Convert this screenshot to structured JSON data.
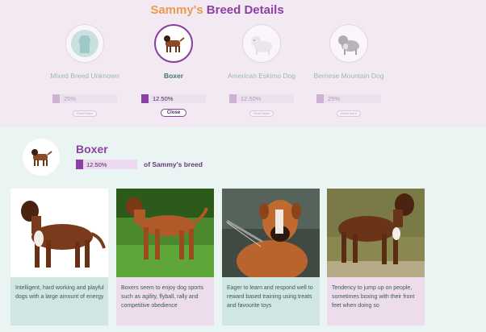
{
  "header": {
    "title_name": "Sammy's",
    "title_rest": "Breed Details"
  },
  "breeds": [
    {
      "name": "Mixed Breed Unknown",
      "percent": "25%",
      "button": "Read more",
      "state": "dim"
    },
    {
      "name": "Boxer",
      "percent": "12.50%",
      "button": "Close",
      "state": "active"
    },
    {
      "name": "American Eskimo Dog",
      "percent": "12.50%",
      "button": "Read more",
      "state": "dim"
    },
    {
      "name": "Bernese Mountain Dog",
      "percent": "25%",
      "button": "Read more",
      "state": "dim"
    }
  ],
  "detail": {
    "name": "Boxer",
    "percent": "12.50%",
    "suffix": "of Sammy's breed"
  },
  "cards": [
    {
      "caption": "Intelligent, hard working and playful dogs with a large amount of energy"
    },
    {
      "caption": "Boxers seem to enjoy dog sports such as agility, flyball, rally and competitive obedience"
    },
    {
      "caption": "Eager to learn and respond well to reward based training using treats and favourite toys"
    },
    {
      "caption": "Tendency to jump up on people, sometimes boxing with their front feet when doing so"
    }
  ],
  "colors": {
    "accent": "#8c3fa4",
    "orange": "#ef9a4a",
    "top_bg": "#f3e9f3",
    "bottom_bg": "#eaf4f2"
  }
}
